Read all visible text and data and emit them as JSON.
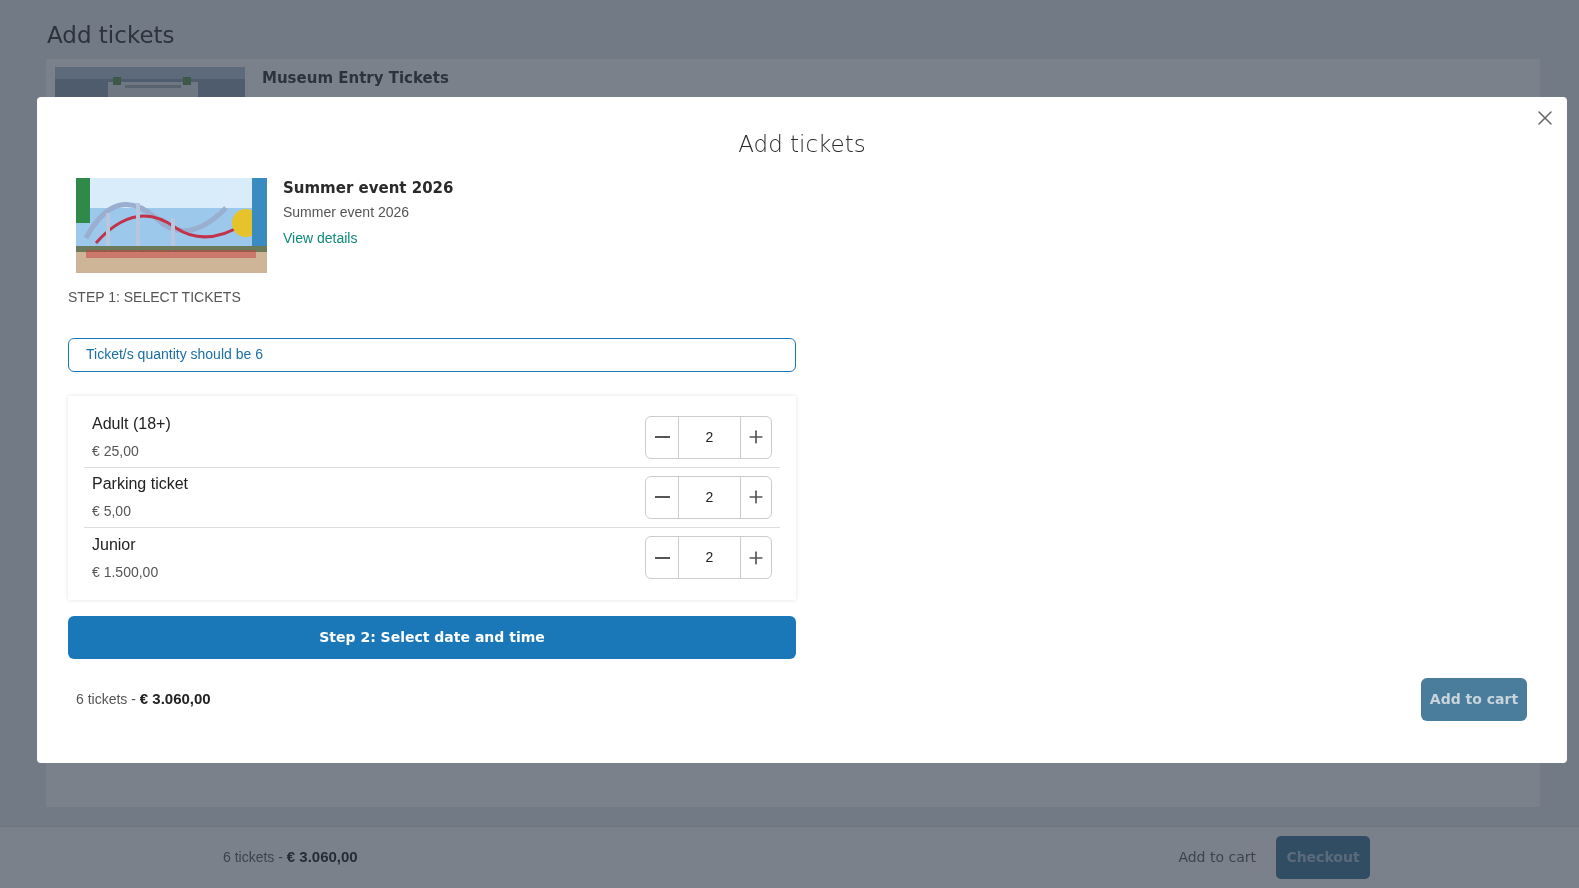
{
  "page": {
    "title": "Add tickets",
    "product_name": "Museum Entry Tickets"
  },
  "footer": {
    "count": "6 tickets",
    "separator": "-",
    "total": "€ 3.060,00",
    "add_to_cart": "Add to cart",
    "checkout": "Checkout"
  },
  "modal": {
    "title": "Add tickets",
    "event": {
      "name": "Summer event 2026",
      "subtitle": "Summer event 2026",
      "link": "View details"
    },
    "step1": "STEP 1: SELECT TICKETS",
    "notice": "Ticket/s quantity should be 6",
    "tickets": [
      {
        "name": "Adult (18+)",
        "price": "€ 25,00",
        "quantity": "2"
      },
      {
        "name": "Parking ticket",
        "price": "€ 5,00",
        "quantity": "2"
      },
      {
        "name": "Junior",
        "price": "€ 1.500,00",
        "quantity": "2"
      }
    ],
    "step2": "Step 2: Select date and time",
    "summary_count": "6 tickets",
    "summary_separator": "-",
    "summary_total": "€ 3.060,00",
    "add_to_cart": "Add to cart"
  }
}
